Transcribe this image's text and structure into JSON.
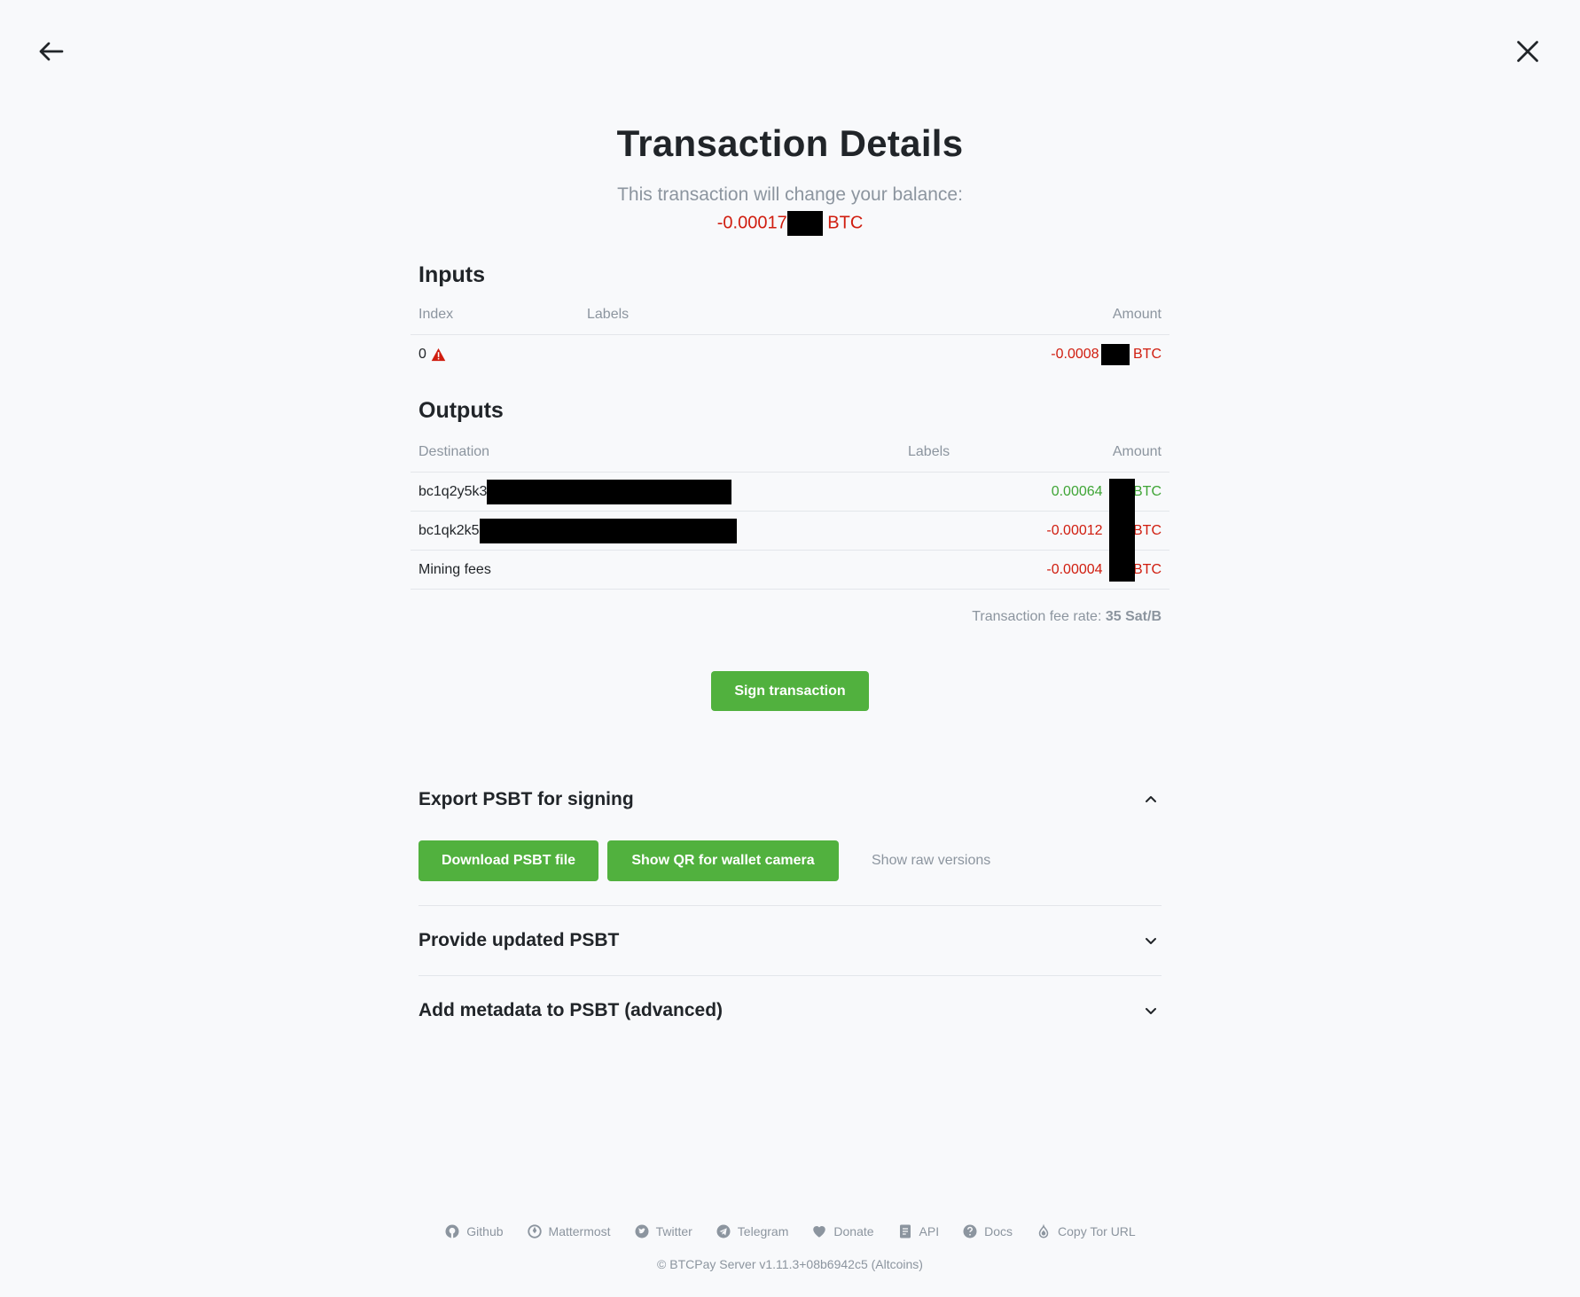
{
  "header": {
    "title": "Transaction Details",
    "subtitle": "This transaction will change your balance:",
    "balance_prefix": "-0.00017",
    "balance_unit": "BTC"
  },
  "inputs": {
    "heading": "Inputs",
    "columns": {
      "index": "Index",
      "labels": "Labels",
      "amount": "Amount"
    },
    "rows": [
      {
        "index": "0",
        "amount_prefix": "-0.0008",
        "unit": "BTC"
      }
    ]
  },
  "outputs": {
    "heading": "Outputs",
    "columns": {
      "destination": "Destination",
      "labels": "Labels",
      "amount": "Amount"
    },
    "rows": [
      {
        "destination": "bc1q2y5k3",
        "amount_prefix": "0.00064",
        "unit": "BTC"
      },
      {
        "destination": "bc1qk2k5",
        "amount_prefix": "-0.00012",
        "unit": "BTC"
      },
      {
        "destination": "Mining fees",
        "amount_prefix": "-0.00004",
        "unit": "BTC"
      }
    ]
  },
  "fee": {
    "label": "Transaction fee rate:",
    "value": "35 Sat/B"
  },
  "sign_button": "Sign transaction",
  "export": {
    "title": "Export PSBT for signing",
    "download_button": "Download PSBT file",
    "qr_button": "Show QR for wallet camera",
    "raw_link": "Show raw versions"
  },
  "provide": {
    "title": "Provide updated PSBT"
  },
  "metadata": {
    "title": "Add metadata to PSBT (advanced)"
  },
  "footer": {
    "links": {
      "github": "Github",
      "mattermost": "Mattermost",
      "twitter": "Twitter",
      "telegram": "Telegram",
      "donate": "Donate",
      "api": "API",
      "docs": "Docs",
      "tor": "Copy Tor URL"
    },
    "copyright": "© BTCPay Server v1.11.3+08b6942c5 (Altcoins)"
  },
  "colors": {
    "accent": "#51b13e",
    "negative": "#d01d0f",
    "positive": "#3fa536",
    "muted": "#8c959f"
  }
}
